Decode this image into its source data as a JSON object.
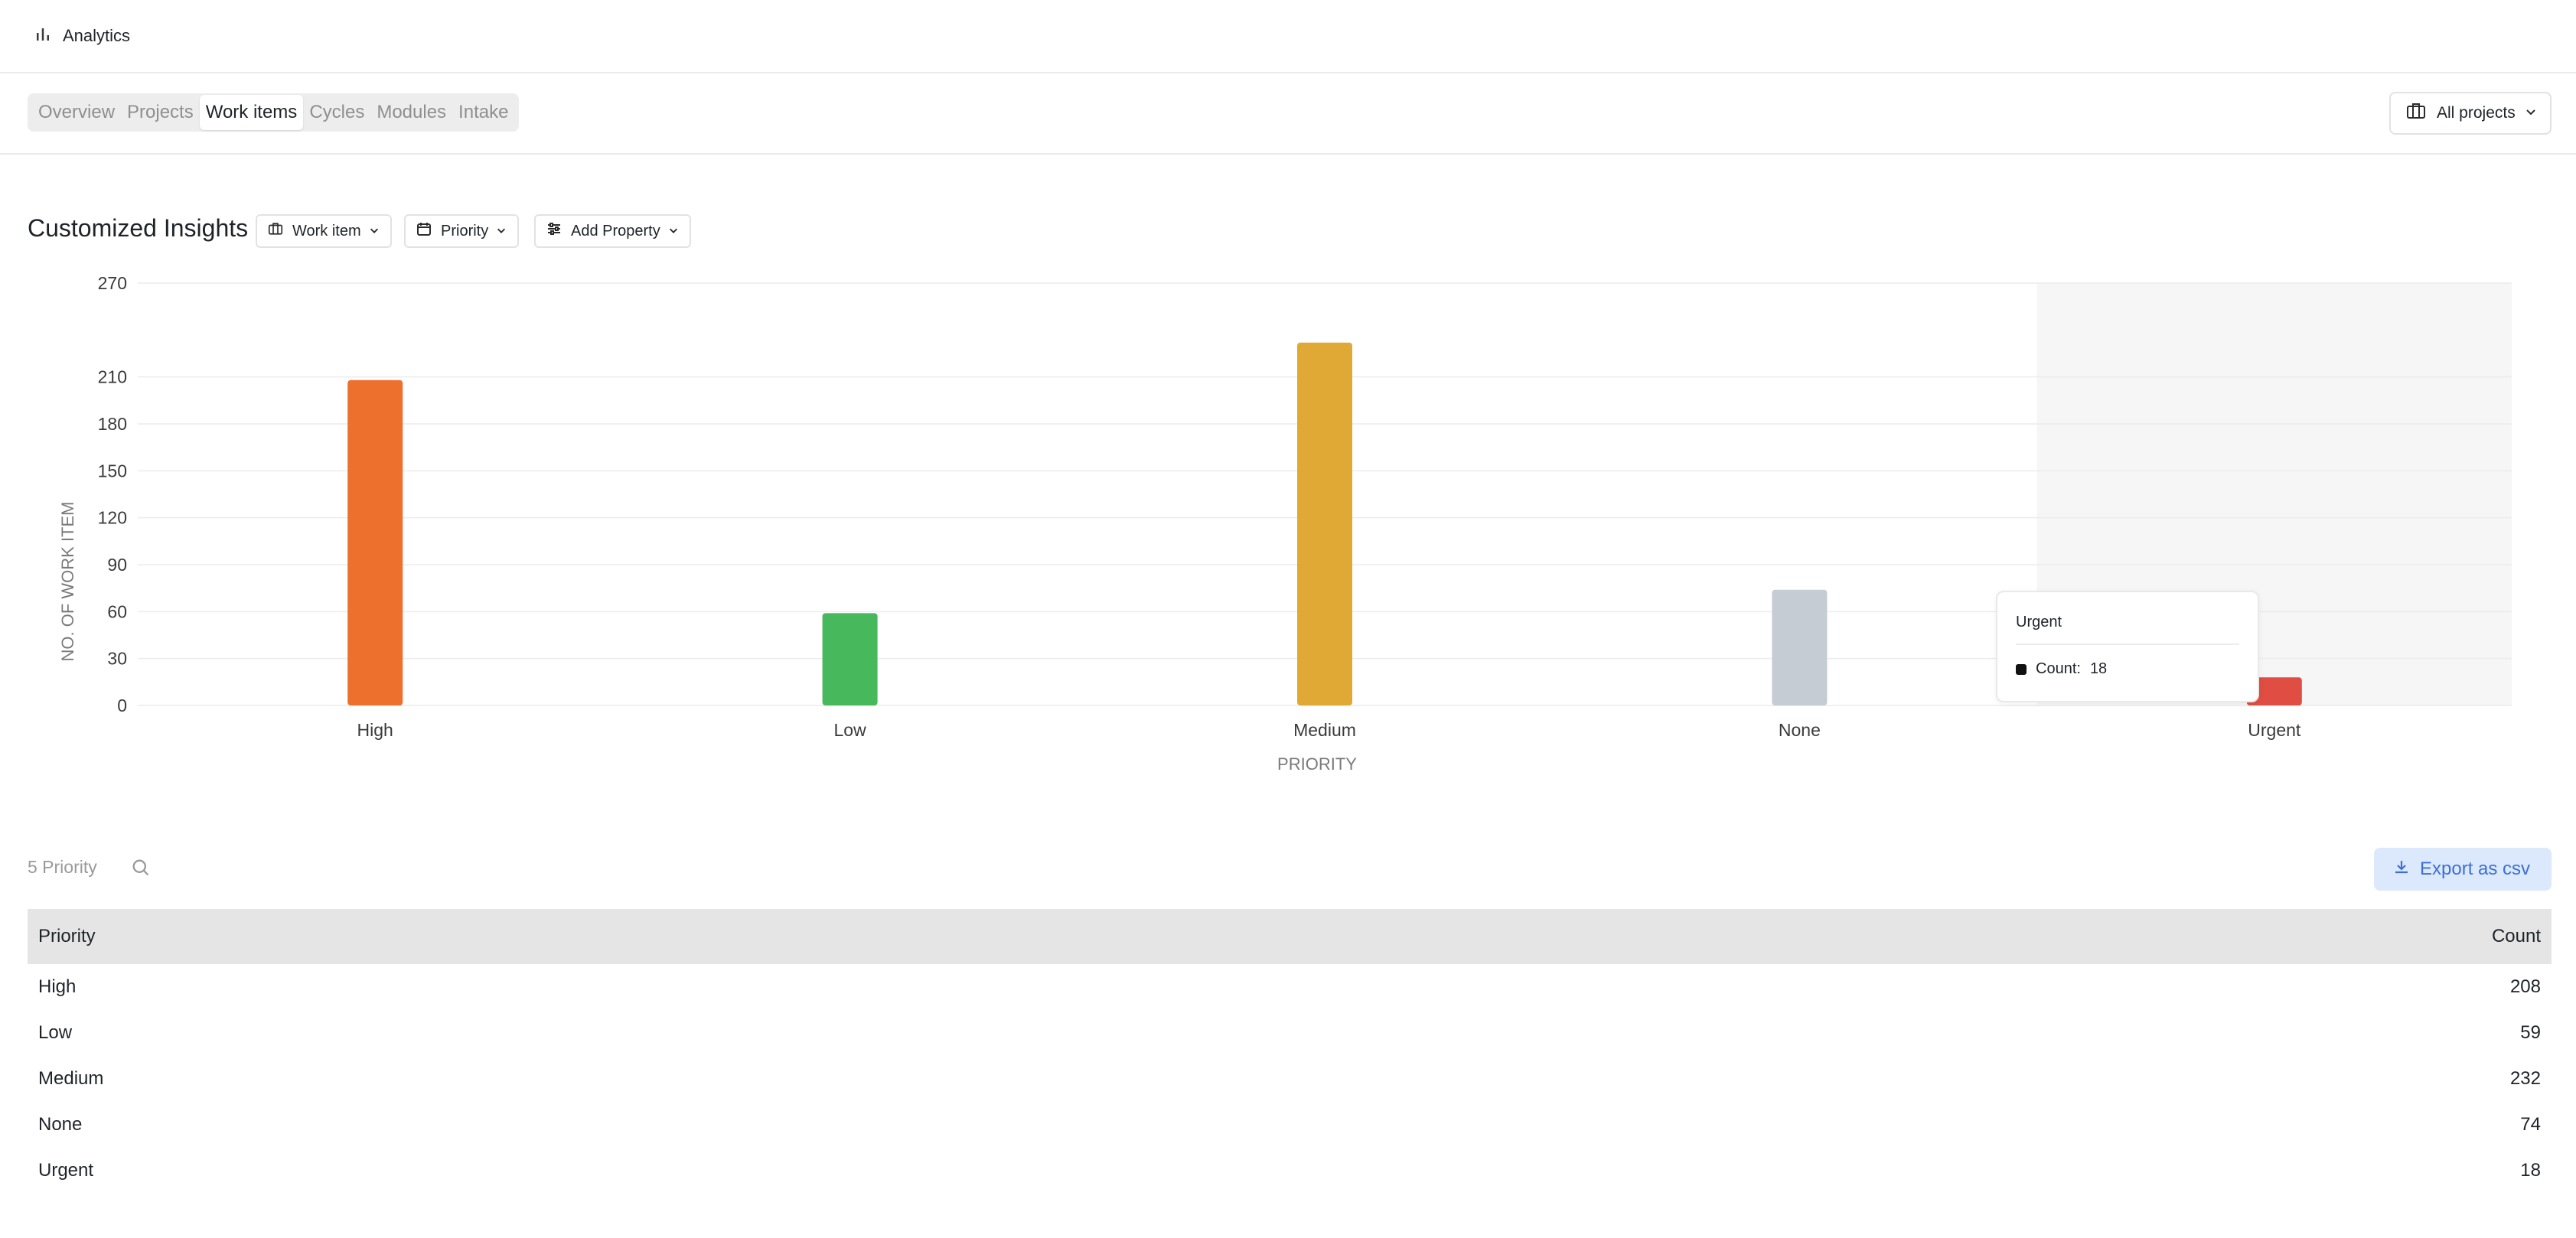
{
  "header": {
    "title": "Analytics",
    "icon": "bar-chart-icon"
  },
  "tabs": [
    {
      "label": "Overview",
      "active": false
    },
    {
      "label": "Projects",
      "active": false
    },
    {
      "label": "Work items",
      "active": true
    },
    {
      "label": "Cycles",
      "active": false
    },
    {
      "label": "Modules",
      "active": false
    },
    {
      "label": "Intake",
      "active": false
    }
  ],
  "projects_filter": {
    "label": "All projects"
  },
  "insights": {
    "title": "Customized Insights",
    "chips": {
      "work_item": "Work item",
      "priority": "Priority",
      "add_property": "Add Property"
    }
  },
  "chart_data": {
    "type": "bar",
    "categories": [
      "High",
      "Low",
      "Medium",
      "None",
      "Urgent"
    ],
    "values": [
      208,
      59,
      232,
      74,
      18
    ],
    "colors": [
      "#ed702d",
      "#48b85c",
      "#e0a935",
      "#c6ccd4",
      "#e04d42"
    ],
    "yticks": [
      0,
      30,
      60,
      90,
      120,
      150,
      180,
      210,
      270
    ],
    "ylim": [
      0,
      270
    ],
    "xlabel": "PRIORITY",
    "ylabel": "NO. OF WORK ITEM",
    "highlighted_category": "Urgent"
  },
  "tooltip": {
    "title": "Urgent",
    "count_label": "Count:",
    "count_value": "18"
  },
  "table": {
    "summary": "5 Priority",
    "export_label": "Export as csv",
    "columns": [
      "Priority",
      "Count"
    ],
    "rows": [
      {
        "priority": "High",
        "count": "208"
      },
      {
        "priority": "Low",
        "count": "59"
      },
      {
        "priority": "Medium",
        "count": "232"
      },
      {
        "priority": "None",
        "count": "74"
      },
      {
        "priority": "Urgent",
        "count": "18"
      }
    ]
  }
}
